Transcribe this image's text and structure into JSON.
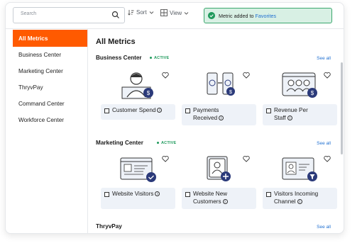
{
  "search": {
    "placeholder": "Search"
  },
  "toolbar": {
    "sort_label": "Sort",
    "view_label": "View"
  },
  "toast": {
    "message": "Metric added to ",
    "link": "Favorites"
  },
  "sidebar": {
    "items": [
      {
        "label": "All Metrics",
        "active": true
      },
      {
        "label": "Business Center"
      },
      {
        "label": "Marketing Center"
      },
      {
        "label": "ThryvPay"
      },
      {
        "label": "Command Center"
      },
      {
        "label": "Workforce Center"
      }
    ]
  },
  "main": {
    "title": "All Metrics",
    "sections": [
      {
        "title": "Business Center",
        "badge": "ACTIVE",
        "see_all": "See all",
        "tiles": [
          {
            "label_line1": "Customer Spend",
            "label_line2": "",
            "icon": "customer-spend-icon"
          },
          {
            "label_line1": "Payments",
            "label_line2": "Received",
            "icon": "payments-received-icon"
          },
          {
            "label_line1": "Revenue Per",
            "label_line2": "Staff",
            "icon": "revenue-per-staff-icon"
          }
        ]
      },
      {
        "title": "Marketing Center",
        "badge": "ACTIVE",
        "see_all": "See all",
        "tiles": [
          {
            "label_line1": "Website Visitors",
            "label_line2": "",
            "icon": "website-visitors-icon"
          },
          {
            "label_line1": "Website New",
            "label_line2": "Customers",
            "icon": "website-new-customers-icon"
          },
          {
            "label_line1": "Visitors Incoming",
            "label_line2": "Channel",
            "icon": "visitors-incoming-channel-icon"
          }
        ]
      },
      {
        "title": "ThryvPay",
        "see_all": "See all"
      }
    ]
  },
  "colors": {
    "accent": "#ff5a00",
    "navy": "#2b3a7a",
    "success": "#1f9a5c",
    "link": "#1f6fd1"
  },
  "info_glyph": "i"
}
